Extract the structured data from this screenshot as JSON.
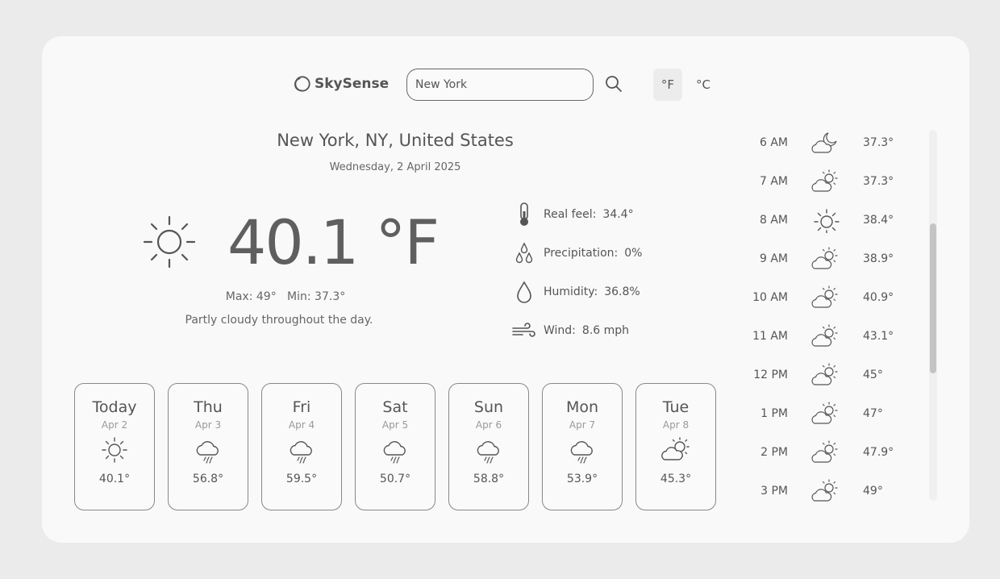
{
  "header": {
    "app_name": "SkySense",
    "search_value": "New York",
    "unit_f": "°F",
    "unit_c": "°C"
  },
  "location": {
    "title": "New York, NY, United States",
    "date": "Wednesday, 2 April 2025"
  },
  "current": {
    "temp": "40.1 °F",
    "icon": "sun-icon",
    "max_min": "Max: 49°   Min: 37.3°",
    "description": "Partly cloudy throughout the day."
  },
  "details": [
    {
      "label": "Real feel:",
      "value": "34.4°",
      "icon": "thermometer-icon"
    },
    {
      "label": "Precipitation:",
      "value": "0%",
      "icon": "droplets-icon"
    },
    {
      "label": "Humidity:",
      "value": "36.8%",
      "icon": "drop-icon"
    },
    {
      "label": "Wind:",
      "value": "8.6 mph",
      "icon": "wind-icon"
    }
  ],
  "daily": [
    {
      "day": "Today",
      "date": "Apr 2",
      "temp": "40.1°",
      "icon": "sun"
    },
    {
      "day": "Thu",
      "date": "Apr 3",
      "temp": "56.8°",
      "icon": "rain"
    },
    {
      "day": "Fri",
      "date": "Apr 4",
      "temp": "59.5°",
      "icon": "rain"
    },
    {
      "day": "Sat",
      "date": "Apr 5",
      "temp": "50.7°",
      "icon": "rain"
    },
    {
      "day": "Sun",
      "date": "Apr 6",
      "temp": "58.8°",
      "icon": "rain"
    },
    {
      "day": "Mon",
      "date": "Apr 7",
      "temp": "53.9°",
      "icon": "rain"
    },
    {
      "day": "Tue",
      "date": "Apr 8",
      "temp": "45.3°",
      "icon": "partly-cloudy"
    }
  ],
  "hourly": [
    {
      "time": "6 AM",
      "temp": "37.3°",
      "icon": "cloud-moon"
    },
    {
      "time": "7 AM",
      "temp": "37.3°",
      "icon": "cloud-sun"
    },
    {
      "time": "8 AM",
      "temp": "38.4°",
      "icon": "sun"
    },
    {
      "time": "9 AM",
      "temp": "38.9°",
      "icon": "cloud-sun"
    },
    {
      "time": "10 AM",
      "temp": "40.9°",
      "icon": "cloud-sun"
    },
    {
      "time": "11 AM",
      "temp": "43.1°",
      "icon": "cloud-sun"
    },
    {
      "time": "12 PM",
      "temp": "45°",
      "icon": "cloud-sun"
    },
    {
      "time": "1 PM",
      "temp": "47°",
      "icon": "cloud-sun"
    },
    {
      "time": "2 PM",
      "temp": "47.9°",
      "icon": "cloud-sun"
    },
    {
      "time": "3 PM",
      "temp": "49°",
      "icon": "cloud-sun"
    }
  ]
}
